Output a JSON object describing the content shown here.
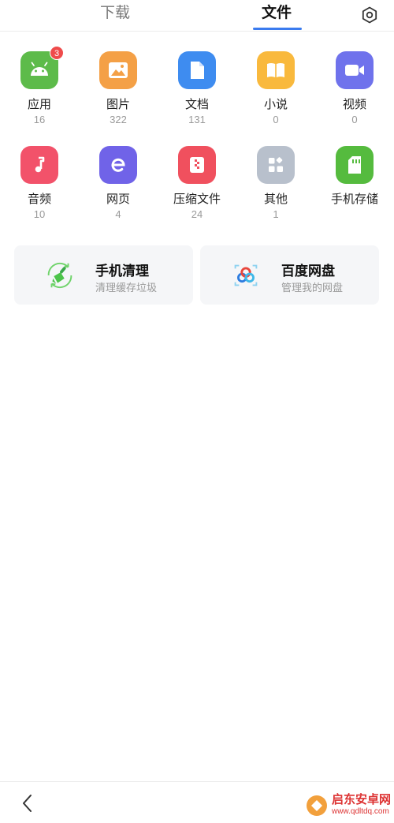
{
  "tabs": {
    "download": "下载",
    "files": "文件"
  },
  "icons": {
    "settings": "settings-icon",
    "back": "back-icon"
  },
  "categories": [
    {
      "name": "app",
      "label": "应用",
      "count": "16",
      "color": "#5dbb4a",
      "icon": "android-icon",
      "badge": "3"
    },
    {
      "name": "image",
      "label": "图片",
      "count": "322",
      "color": "#f4a046",
      "icon": "image-icon"
    },
    {
      "name": "doc",
      "label": "文档",
      "count": "131",
      "color": "#3e8cf0",
      "icon": "document-icon"
    },
    {
      "name": "novel",
      "label": "小说",
      "count": "0",
      "color": "#f9b93d",
      "icon": "book-icon"
    },
    {
      "name": "video",
      "label": "视频",
      "count": "0",
      "color": "#6f72ec",
      "icon": "video-icon"
    },
    {
      "name": "audio",
      "label": "音频",
      "count": "10",
      "color": "#f2526a",
      "icon": "music-icon"
    },
    {
      "name": "web",
      "label": "网页",
      "count": "4",
      "color": "#7063e8",
      "icon": "web-icon"
    },
    {
      "name": "zip",
      "label": "压缩文件",
      "count": "24",
      "color": "#f0505e",
      "icon": "zip-icon"
    },
    {
      "name": "other",
      "label": "其他",
      "count": "1",
      "color": "#b8c0cc",
      "icon": "grid-icon"
    },
    {
      "name": "storage",
      "label": "手机存储",
      "count": "",
      "color": "#55bb3e",
      "icon": "sd-card-icon"
    }
  ],
  "cards": {
    "clean": {
      "title": "手机清理",
      "subtitle": "清理缓存垃圾"
    },
    "pan": {
      "title": "百度网盘",
      "subtitle": "管理我的网盘"
    }
  },
  "watermark": {
    "brand": "启东安卓网",
    "url": "www.qdltdq.com"
  }
}
